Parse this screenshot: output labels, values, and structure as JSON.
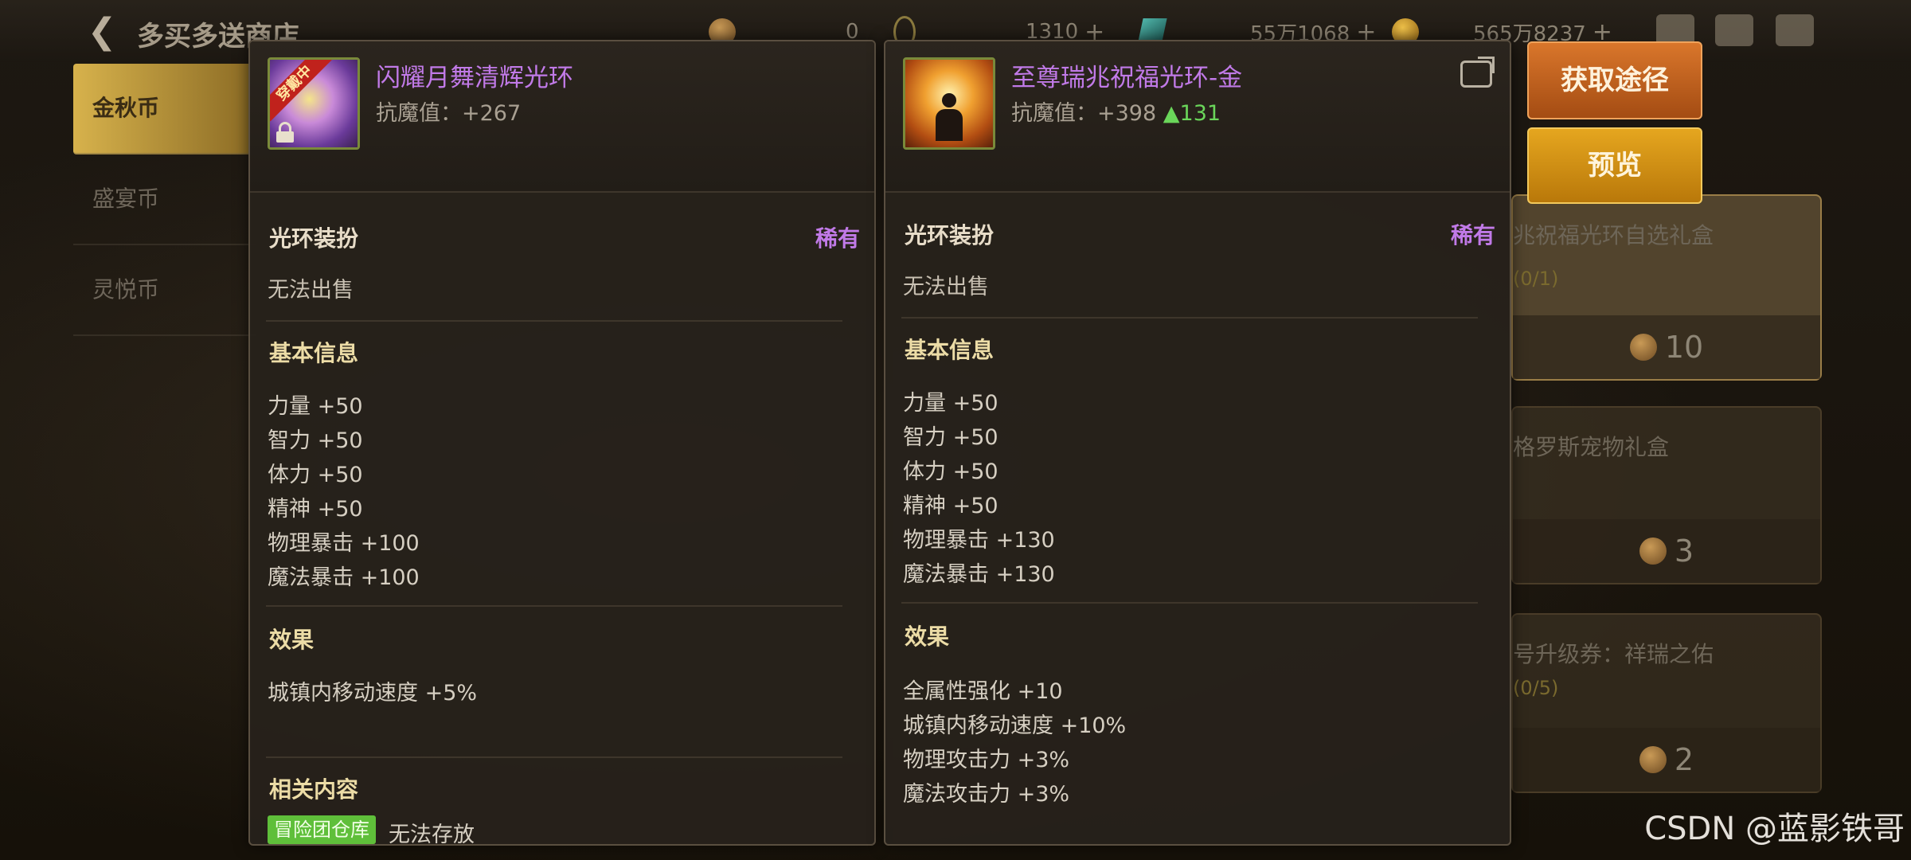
{
  "topbar": {
    "title": "多买多送商店",
    "currencies": [
      "0",
      "1310",
      "55万1068",
      "565万8237"
    ]
  },
  "sidebar": {
    "tabs": [
      "金秋币",
      "盛宴币",
      "灵悦币"
    ]
  },
  "shop_list": [
    {
      "name": "兆祝福光环自选礼盒",
      "limit": "(0/1)",
      "price": "10"
    },
    {
      "name": "格罗斯宠物礼盒",
      "limit": "",
      "price": "3"
    },
    {
      "name": "号升级券：祥瑞之佑",
      "limit": "(0/5)",
      "price": "2"
    }
  ],
  "buttons": {
    "obtain": "获取途径",
    "preview": "预览"
  },
  "left_item": {
    "badge": "穿戴中",
    "name": "闪耀月舞清辉光环",
    "resist": "抗魔值：+267",
    "category": "光环装扮",
    "rarity": "稀有",
    "sell": "无法出售",
    "basic_title": "基本信息",
    "stats": [
      "力量 +50",
      "智力 +50",
      "体力 +50",
      "精神 +50",
      "物理暴击 +100",
      "魔法暴击 +100"
    ],
    "effect_title": "效果",
    "effects": [
      "城镇内移动速度 +5%"
    ],
    "related_title": "相关内容",
    "related_tag": "冒险团仓库",
    "related_text": "无法存放"
  },
  "right_item": {
    "name": "至尊瑞兆祝福光环-金",
    "resist": "抗魔值：+398",
    "resist_up": "▲131",
    "category": "光环装扮",
    "rarity": "稀有",
    "sell": "无法出售",
    "basic_title": "基本信息",
    "stats": [
      "力量 +50",
      "智力 +50",
      "体力 +50",
      "精神 +50",
      "物理暴击 +130",
      "魔法暴击 +130"
    ],
    "effect_title": "效果",
    "effects": [
      "全属性强化 +10",
      "城镇内移动速度 +10%",
      "物理攻击力 +3%",
      "魔法攻击力 +3%"
    ]
  },
  "watermark": "CSDN @蓝影铁哥",
  "colors": {
    "rare": "#c17ae8",
    "section": "#ecdca6",
    "stat_up": "#6ad65a"
  }
}
